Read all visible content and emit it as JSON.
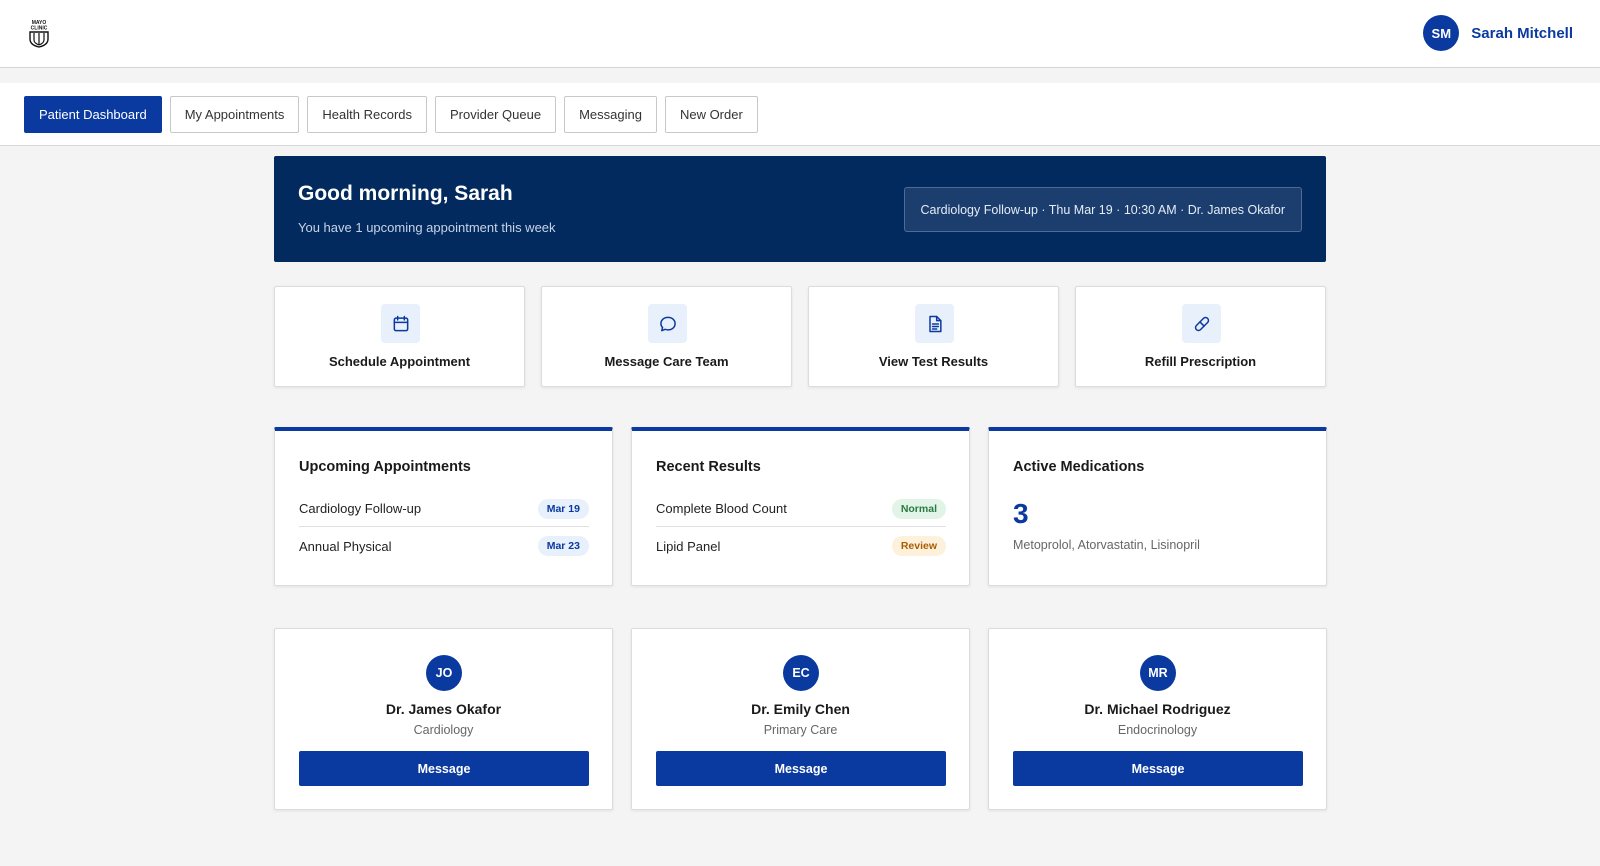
{
  "header": {
    "logo_text": [
      "MAYO",
      "CLINIC"
    ],
    "user": {
      "initials": "SM",
      "name": "Sarah Mitchell"
    }
  },
  "nav": {
    "tabs": [
      {
        "label": "Patient Dashboard",
        "active": true
      },
      {
        "label": "My Appointments",
        "active": false
      },
      {
        "label": "Health Records",
        "active": false
      },
      {
        "label": "Provider Queue",
        "active": false
      },
      {
        "label": "Messaging",
        "active": false
      },
      {
        "label": "New Order",
        "active": false
      }
    ]
  },
  "hero": {
    "greeting": "Good morning, Sarah",
    "subtitle": "You have 1 upcoming appointment this week",
    "next_appointment": "Cardiology Follow-up · Thu Mar 19 · 10:30 AM · Dr. James Okafor"
  },
  "quick_actions": [
    {
      "label": "Schedule Appointment",
      "icon": "calendar-icon"
    },
    {
      "label": "Message Care Team",
      "icon": "chat-bubble-icon"
    },
    {
      "label": "View Test Results",
      "icon": "document-icon"
    },
    {
      "label": "Refill Prescription",
      "icon": "pill-icon"
    }
  ],
  "appointments": {
    "title": "Upcoming Appointments",
    "items": [
      {
        "name": "Cardiology Follow-up",
        "date": "Mar 19"
      },
      {
        "name": "Annual Physical",
        "date": "Mar 23"
      }
    ]
  },
  "results": {
    "title": "Recent Results",
    "items": [
      {
        "name": "Complete Blood Count",
        "status": "Normal"
      },
      {
        "name": "Lipid Panel",
        "status": "Review"
      }
    ]
  },
  "medications": {
    "title": "Active Medications",
    "count": "3",
    "list": "Metoprolol, Atorvastatin, Lisinopril"
  },
  "providers": [
    {
      "initials": "JO",
      "name": "Dr. James Okafor",
      "specialty": "Cardiology",
      "button": "Message"
    },
    {
      "initials": "EC",
      "name": "Dr. Emily Chen",
      "specialty": "Primary Care",
      "button": "Message"
    },
    {
      "initials": "MR",
      "name": "Dr. Michael Rodriguez",
      "specialty": "Endocrinology",
      "button": "Message"
    }
  ],
  "colors": {
    "brand_blue": "#0a3aa0",
    "hero_navy": "#032a5e",
    "status_normal": "#2a7a41",
    "status_review": "#a85d00"
  }
}
